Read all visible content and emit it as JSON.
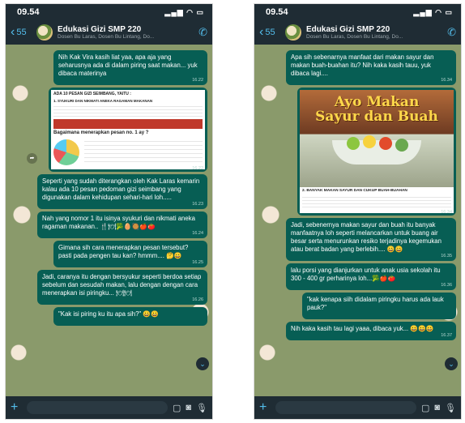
{
  "left": {
    "status": {
      "time": "09.54"
    },
    "header": {
      "back_count": "55",
      "title": "Edukasi Gizi SMP 220",
      "subtitle": "Dosen Bu Laras, Dosen Bu Lintang, Do..."
    },
    "messages": [
      {
        "text": "Nih Kak Vira kasih liat yaa, apa aja yang seharusnya ada di dalam piring saat makan... yuk dibaca materinya",
        "time": "16.22"
      },
      {
        "text": "Seperti yang sudah diterangkan oleh Kak Laras kemarin kalau ada 10 pesan pedoman gizi seimbang yang digunakan dalam kehidupan sehari-hari loh.....",
        "time": "16.23"
      },
      {
        "text": "Nah yang nomor 1 itu isinya syukuri dan nikmati aneka ragaman makanan.. 🍴🍽🥦🥚🥘🍎🍅",
        "time": "16.24"
      },
      {
        "text": "Gimana sih cara menerapkan pesan tersebut? pasti pada pengen tau kan? hmmm.... 🤔😀",
        "time": "16.25"
      },
      {
        "text": "Jadi, caranya itu dengan bersyukur seperti berdoa setiap sebelum dan sesudah makan, lalu dengan dengan cara menerapkan isi piringku... 🍽🍽",
        "time": "16.26"
      },
      {
        "text": "\"Kak isi piring ku itu apa sih?\" 😀😀",
        "time": ""
      }
    ],
    "doc": {
      "title": "ADA 10 PESAN GIZI SEIMBANG, YAITU :",
      "subtitle": "1. SYUKURI DAN NIKMATI ANEKA RAGAMAN MAKANAN",
      "question": "Bagaimana menerapkan pesan no. 1 ay ?",
      "time": "16.22"
    }
  },
  "right": {
    "status": {
      "time": "09.54"
    },
    "header": {
      "back_count": "55",
      "title": "Edukasi Gizi SMP 220",
      "subtitle": "Dosen Bu Laras, Dosen Bu Lintang, Do..."
    },
    "messages": [
      {
        "text": "Apa sih sebenarnya manfaat dari makan sayur dan makan buah-buahan itu? Nih kaka kasih tauu, yuk dibaca lagi....",
        "time": "16.34"
      },
      {
        "text": "Jadi, sebenernya makan sayur dan buah itu banyak manfaatnya loh seperti melancarkan untuk buang air besar serta menurunkan resiko terjadinya kegemukan atau berat badan yang berlebih.... 😀😀",
        "time": "16.35"
      },
      {
        "text": "lalu porsi yang dianjurkan untuk anak usia sekolah itu 300 - 400 gr perharinya loh...🥦🍎🍅",
        "time": "16.36"
      },
      {
        "text": "\"kak kenapa siih didalam piringku harus ada lauk pauk?\"",
        "time": ""
      },
      {
        "text": "Nih kaka kasih tau lagi yaaa, dibaca yuk... 😀😀😀",
        "time": "16.37"
      }
    ],
    "poster": {
      "title_line1": "Ayo Makan",
      "title_line2": "Sayur dan Buah",
      "section": "2. BANYAK MAKAN SAYUR DAN CUKUP BUAH-BUAHAN",
      "time": "16.34"
    }
  }
}
